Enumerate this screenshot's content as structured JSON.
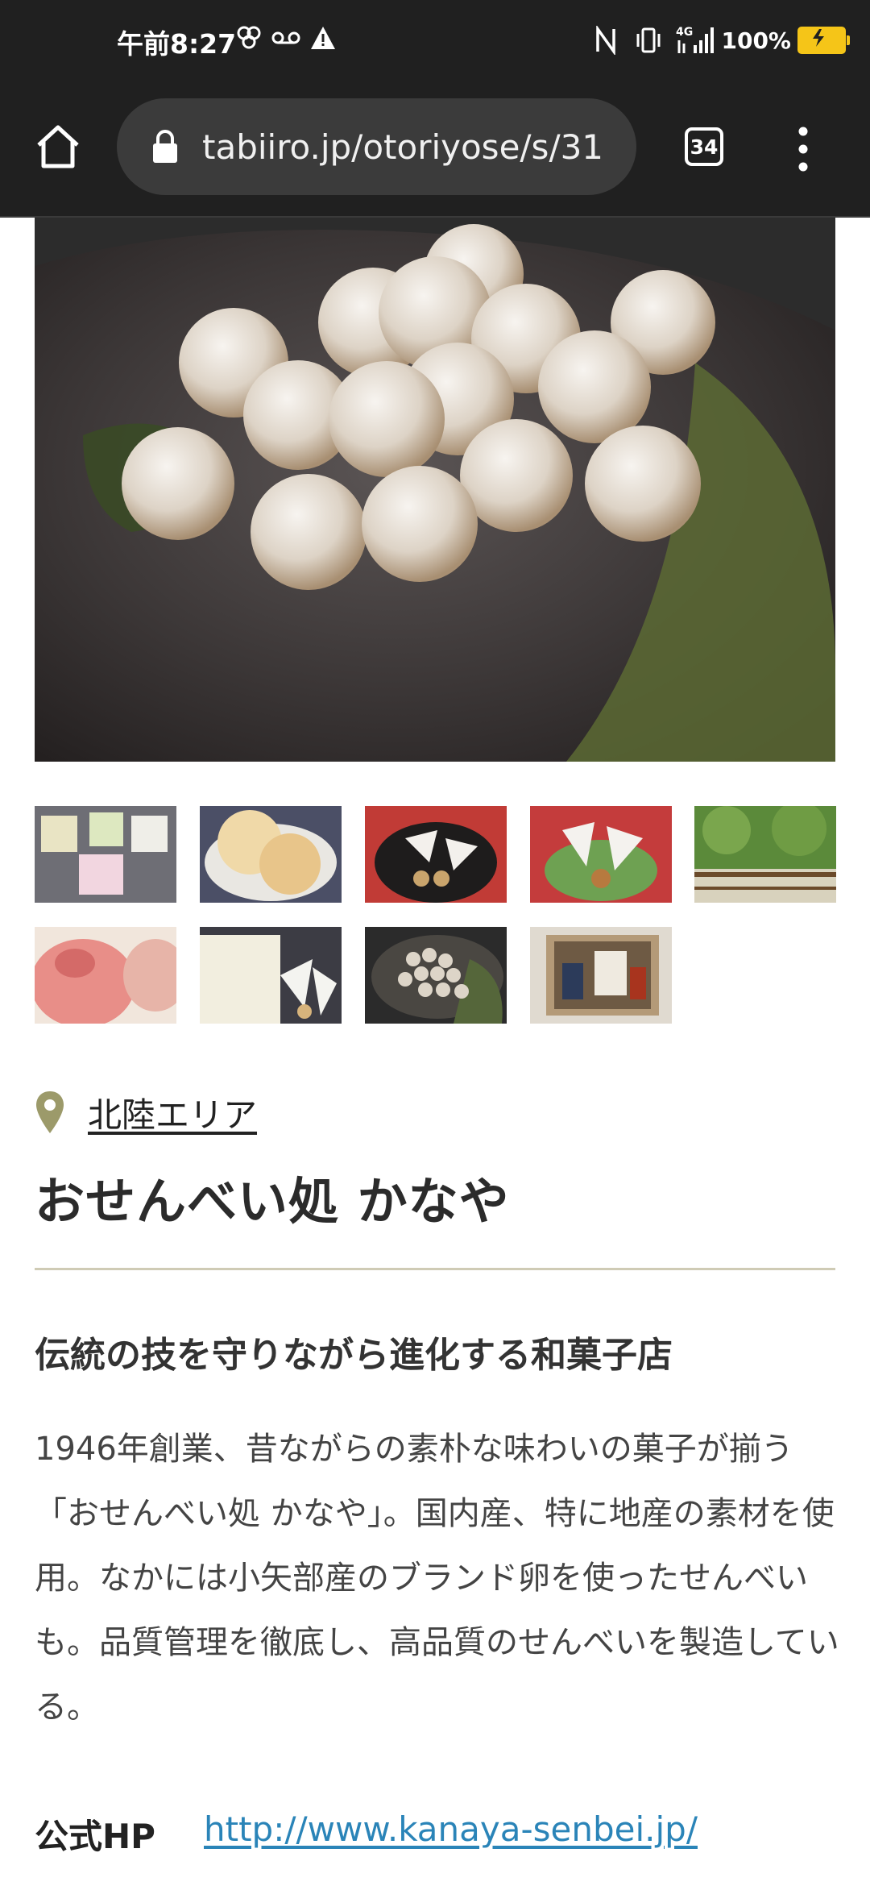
{
  "status_bar": {
    "time": "午前8:27",
    "battery_percent": "100%",
    "network": "4G"
  },
  "browser": {
    "url": "tabiiro.jp/otoriyose/s/31",
    "tab_count": "34"
  },
  "shop": {
    "area": "北陸エリア",
    "name": "おせんべい処 かなや",
    "subtitle": "伝統の技を守りながら進化する和菓子店",
    "description": "1946年創業、昔ながらの素朴な味わいの菓子が揃う「おせんべい処 かなや」。国内産、特に地産の素材を使用。なかには小矢部産のブランド卵を使ったせんべいも。品質管理を徹底し、高品質のせんべいを製造している。",
    "hp_label": "公式HP",
    "hp_url": "http://www.kanaya-senbei.jp/"
  },
  "colors": {
    "toolbar_bg": "#202020",
    "link_blue": "#2a84b8",
    "divider": "#cfcbb5",
    "pin": "#9c9a6a"
  }
}
